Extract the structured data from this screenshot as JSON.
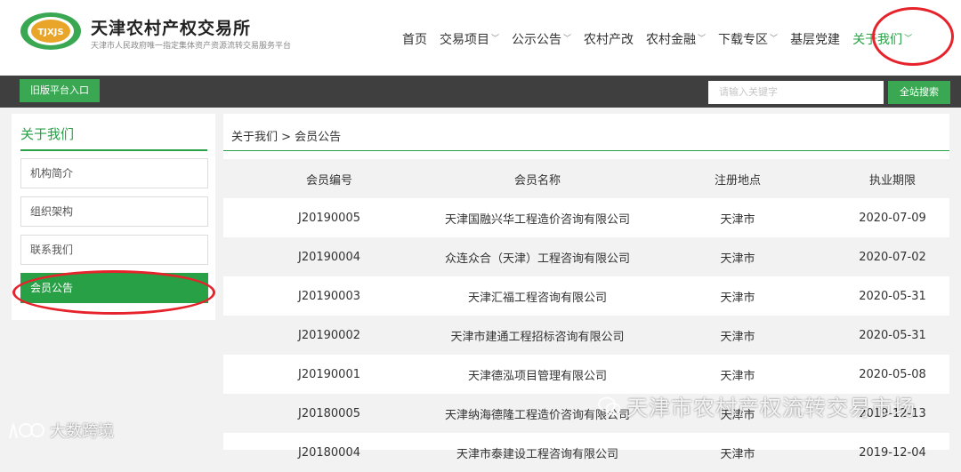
{
  "brand": {
    "emblem_text": "TJXJS",
    "title": "天津农村产权交易所",
    "subtitle": "天津市人民政府唯一指定集体资产资源流转交易服务平台"
  },
  "nav": {
    "items": [
      {
        "label": "首页"
      },
      {
        "label": "交易项目"
      },
      {
        "label": "公示公告"
      },
      {
        "label": "农村产改"
      },
      {
        "label": "农村金融"
      },
      {
        "label": "下载专区"
      },
      {
        "label": "基层党建"
      },
      {
        "label": "关于我们"
      }
    ]
  },
  "toolbar": {
    "old_platform_label": "旧版平台入口",
    "search_placeholder": "请输入关键字",
    "search_button_label": "全站搜索"
  },
  "sidebar": {
    "title": "关于我们",
    "items": [
      {
        "label": "机构简介"
      },
      {
        "label": "组织架构"
      },
      {
        "label": "联系我们"
      },
      {
        "label": "会员公告"
      }
    ],
    "active_index": 3
  },
  "main": {
    "breadcrumb": "关于我们 > 会员公告",
    "columns": [
      "会员编号",
      "会员名称",
      "注册地点",
      "执业期限"
    ],
    "rows": [
      {
        "id": "J20190005",
        "name": "天津国融兴华工程造价咨询有限公司",
        "place": "天津市",
        "term": "2020-07-09"
      },
      {
        "id": "J20190004",
        "name": "众连众合（天津）工程咨询有限公司",
        "place": "天津市",
        "term": "2020-07-02"
      },
      {
        "id": "J20190003",
        "name": "天津汇福工程咨询有限公司",
        "place": "天津市",
        "term": "2020-05-31"
      },
      {
        "id": "J20190002",
        "name": "天津市建通工程招标咨询有限公司",
        "place": "天津市",
        "term": "2020-05-31"
      },
      {
        "id": "J20190001",
        "name": "天津德泓项目管理有限公司",
        "place": "天津市",
        "term": "2020-05-08"
      },
      {
        "id": "J20180005",
        "name": "天津纳海德隆工程造价咨询有限公司",
        "place": "天津市",
        "term": "2019-12-13"
      },
      {
        "id": "J20180004",
        "name": "天津市泰建设工程咨询有限公司",
        "place": "天津市",
        "term": "2019-12-04"
      }
    ]
  },
  "watermarks": {
    "right": "天津市农村产权流转交易市场",
    "left": "大数跨境"
  },
  "colors": {
    "accent_green": "#27a046",
    "button_green": "#3aa853",
    "toolbar_dark": "#3f3f3f",
    "highlight_red": "#e6232b"
  }
}
